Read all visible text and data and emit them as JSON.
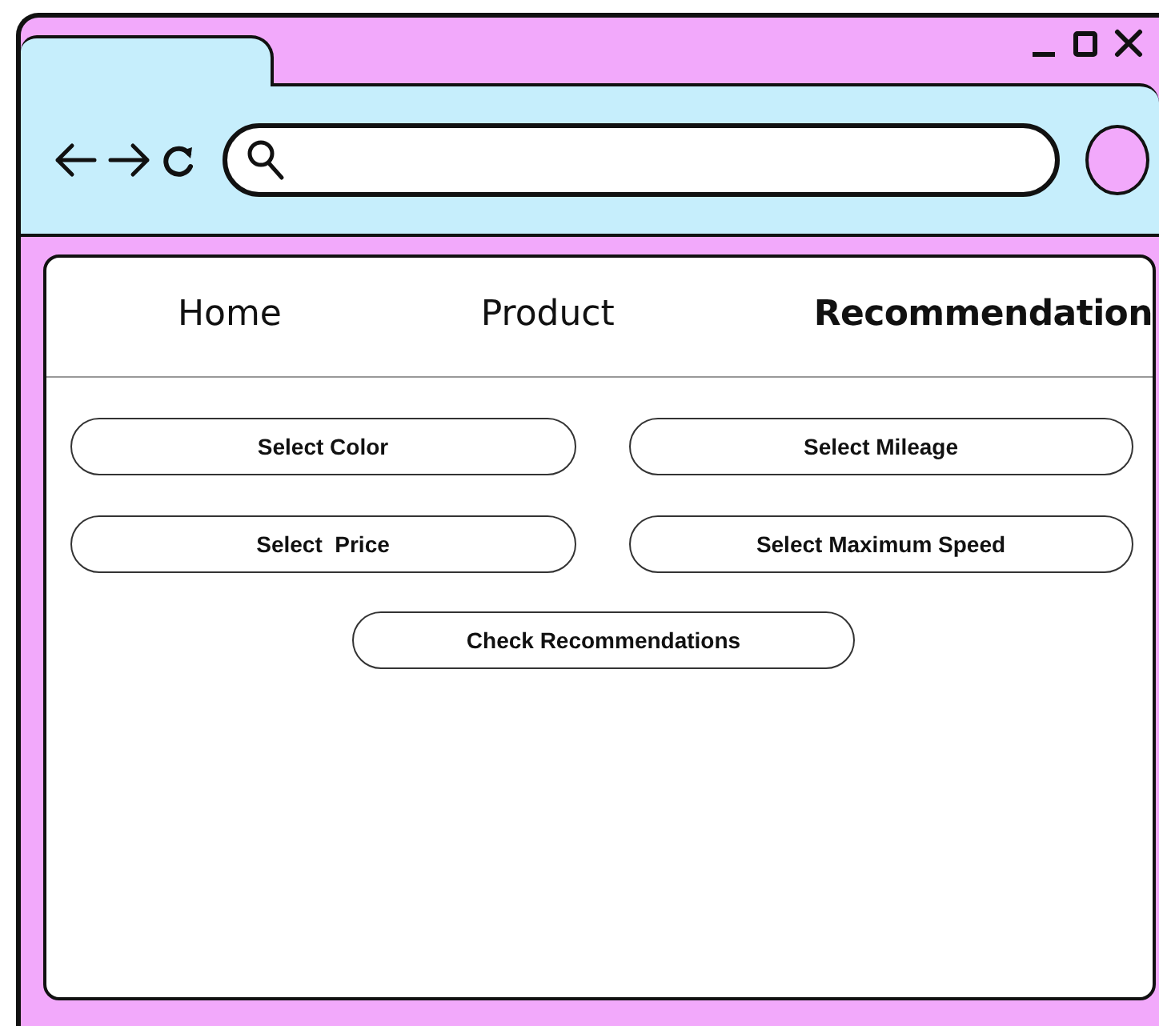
{
  "nav": [
    {
      "label": "Home",
      "selected": false
    },
    {
      "label": "Product",
      "selected": false
    },
    {
      "label": "Recommendation",
      "selected": true
    }
  ],
  "filters": [
    "Select Color",
    "Select Mileage",
    "Select  Price",
    "Select Maximum Speed"
  ],
  "action": "Check Recommendations"
}
